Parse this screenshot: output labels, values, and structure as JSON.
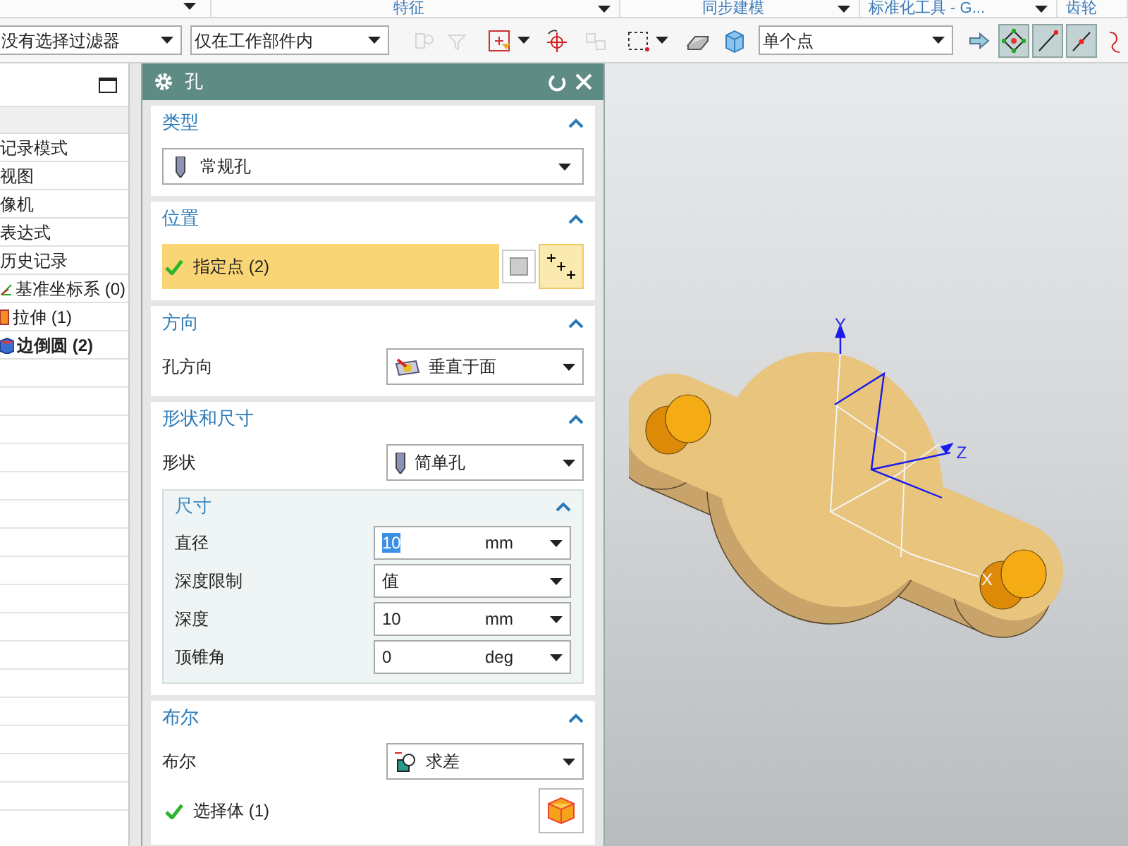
{
  "ribbon": {
    "groups": [
      {
        "label": "特征"
      },
      {
        "label": "同步建模"
      },
      {
        "label": "标准化工具 - G..."
      },
      {
        "label": "齿轮"
      }
    ]
  },
  "toolbar": {
    "filter": "没有选择过滤器",
    "scope": "仅在工作部件内",
    "snap_mode": "单个点",
    "icons": [
      {
        "disabled": true,
        "on": false
      },
      {
        "disabled": true,
        "on": false
      },
      {
        "disabled": false,
        "on": false
      },
      {
        "disabled": false,
        "on": false
      },
      {
        "disabled": true,
        "on": false
      },
      {
        "disabled": false,
        "on": false
      },
      {
        "disabled": false,
        "on": false
      },
      {
        "disabled": false,
        "on": false
      }
    ],
    "snap_icons": [
      {
        "on": false
      },
      {
        "on": true
      },
      {
        "on": true
      },
      {
        "on": true
      },
      {
        "on": false
      }
    ]
  },
  "part_navigator": {
    "rows": [
      {
        "label": "记录模式",
        "bold": false
      },
      {
        "label": "视图",
        "bold": false
      },
      {
        "label": "像机",
        "bold": false
      },
      {
        "label": "表达式",
        "bold": false
      },
      {
        "label": "历史记录",
        "bold": false
      },
      {
        "label": "基准坐标系 (0)",
        "bold": false
      },
      {
        "label": "拉伸 (1)",
        "bold": false
      },
      {
        "label": "边倒圆 (2)",
        "bold": true
      }
    ]
  },
  "dialog": {
    "title": "孔",
    "sections": [
      {
        "title": "类型",
        "expanded": true,
        "rows": [
          {
            "kind": "wide_dropdown",
            "value": "常规孔"
          }
        ]
      },
      {
        "title": "位置",
        "expanded": true,
        "rows": [
          {
            "kind": "selection",
            "label": "指定点 (2)",
            "active": true
          }
        ]
      },
      {
        "title": "方向",
        "expanded": true,
        "rows": [
          {
            "kind": "dropdown",
            "label": "孔方向",
            "value": "垂直于面"
          }
        ]
      },
      {
        "title": "形状和尺寸",
        "expanded": true,
        "rows": [
          {
            "kind": "dropdown",
            "label": "形状",
            "value": "简单孔"
          }
        ],
        "subsection": {
          "title": "尺寸",
          "expanded": true,
          "rows": [
            {
              "kind": "number",
              "label": "直径",
              "value": "10",
              "unit": "mm",
              "highlighted": true
            },
            {
              "kind": "choice",
              "label": "深度限制",
              "value": "值"
            },
            {
              "kind": "number",
              "label": "深度",
              "value": "10",
              "unit": "mm",
              "highlighted": false
            },
            {
              "kind": "number",
              "label": "顶锥角",
              "value": "0",
              "unit": "deg",
              "highlighted": false
            }
          ]
        }
      },
      {
        "title": "布尔",
        "expanded": true,
        "rows": [
          {
            "kind": "dropdown",
            "label": "布尔",
            "value": "求差"
          },
          {
            "kind": "selection",
            "label": "选择体 (1)",
            "active": false
          }
        ]
      }
    ]
  },
  "viewport": {
    "axes": [
      {
        "label": "Y"
      },
      {
        "label": "Z"
      },
      {
        "label": "X"
      }
    ]
  }
}
